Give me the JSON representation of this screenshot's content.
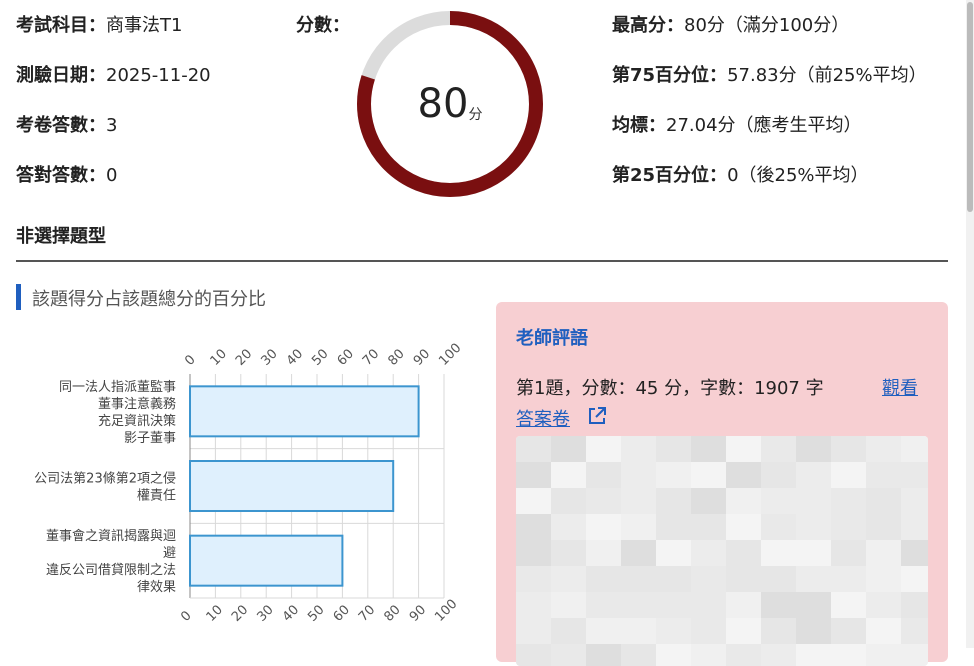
{
  "left_info": [
    {
      "label": "考試科目：",
      "value": "商事法T1"
    },
    {
      "label": "測驗日期：",
      "value": "2025-11-20"
    },
    {
      "label": "考卷答數：",
      "value": "3"
    },
    {
      "label": "答對答數：",
      "value": "0"
    }
  ],
  "score": {
    "label": "分數：",
    "value": "80",
    "unit": "分",
    "percent": 80,
    "fill_color": "#7a0f10",
    "track_color": "#dcdcdc"
  },
  "right_info": [
    {
      "label": "最高分：",
      "value": "80分（滿分100分）"
    },
    {
      "label": "第75百分位：",
      "value": "57.83分（前25%平均）"
    },
    {
      "label": "均標：",
      "value": "27.04分（應考生平均）"
    },
    {
      "label": "第25百分位：",
      "value": "0（後25%平均）"
    }
  ],
  "section_title": "非選擇題型",
  "chart_title": "該題得分占該題總分的百分比",
  "chart_data": {
    "type": "bar",
    "orientation": "horizontal",
    "categories": [
      [
        "同一法人指派董監事",
        "董事注意義務",
        "充足資訊決策",
        "影子董事"
      ],
      [
        "公司法第23條第2項之侵",
        "權責任"
      ],
      [
        "董事會之資訊揭露與迴",
        "避",
        "違反公司借貸限制之法",
        "律效果"
      ]
    ],
    "values": [
      90,
      80,
      60
    ],
    "xlim": [
      0,
      100
    ],
    "xticks": [
      "0",
      "10",
      "20",
      "30",
      "40",
      "50",
      "60",
      "70",
      "80",
      "90",
      "100"
    ],
    "grid": true,
    "bar_fill": "#dff0fd",
    "bar_stroke": "#3c95cf"
  },
  "teacher": {
    "title": "老師評語",
    "comment_line": "第1題，分數：45 分，字數：1907 字",
    "link_text_1": "觀看",
    "link_text_2": "答案卷"
  }
}
